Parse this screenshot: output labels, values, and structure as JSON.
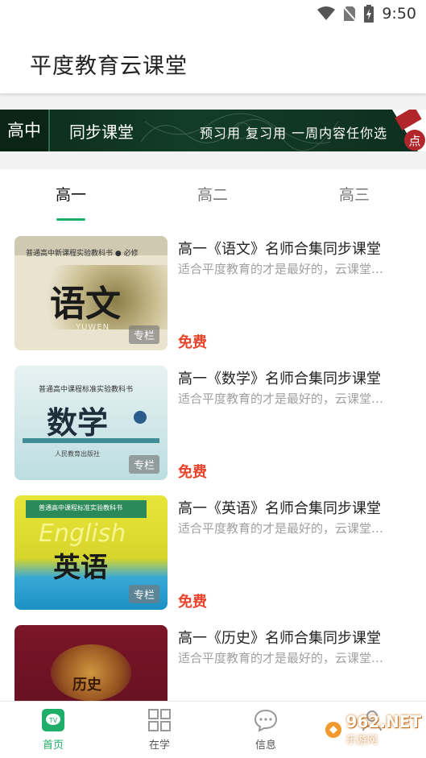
{
  "status_bar": {
    "time": "9:50"
  },
  "header": {
    "title": "平度教育云课堂"
  },
  "banner": {
    "tag": "高中",
    "subtitle": "同步课堂",
    "slogan": "预习用 复习用 一周内容任你选",
    "corner_text": "点",
    "corner_top": "点"
  },
  "tabs": [
    {
      "label": "高一",
      "active": true
    },
    {
      "label": "高二",
      "active": false
    },
    {
      "label": "高三",
      "active": false
    }
  ],
  "courses": [
    {
      "title": "高一《语文》名师合集同步课堂",
      "desc": "适合平度教育的才是最好的，云课堂…",
      "price": "免费",
      "badge": "专栏",
      "cover": {
        "top_note": "普通高中新课程实验教科书 ● 必修",
        "big": "语文",
        "small": "YUWEN"
      }
    },
    {
      "title": "高一《数学》名师合集同步课堂",
      "desc": "适合平度教育的才是最好的，云课堂…",
      "price": "免费",
      "badge": "专栏",
      "cover": {
        "top_note": "普通高中课程标准实验教科书",
        "big": "数学",
        "small": "人民教育出版社"
      }
    },
    {
      "title": "高一《英语》名师合集同步课堂",
      "desc": "适合平度教育的才是最好的，云课堂…",
      "price": "免费",
      "badge": "专栏",
      "cover": {
        "top_note": "普通高中课程标准实验教科书",
        "big": "英语",
        "small": "English"
      }
    },
    {
      "title": "高一《历史》名师合集同步课堂",
      "desc": "适合平度教育的才是最好的，云课堂…",
      "price": "",
      "badge": "",
      "cover": {
        "top_note": "",
        "big": "历史",
        "small": ""
      }
    }
  ],
  "bottom_nav": [
    {
      "label": "首页",
      "icon": "home-icon",
      "active": true
    },
    {
      "label": "在学",
      "icon": "grid-icon",
      "active": false
    },
    {
      "label": "信息",
      "icon": "chat-icon",
      "active": false
    },
    {
      "label": "",
      "icon": "profile-icon",
      "active": false
    }
  ],
  "watermark": {
    "text": "962.NET",
    "sub": "乐游网"
  },
  "colors": {
    "accent": "#1fae6a",
    "price": "#e8432b",
    "banner_bg": "#133d28"
  }
}
